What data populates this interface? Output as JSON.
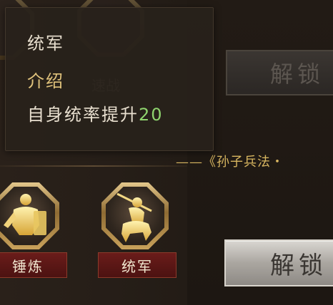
{
  "tooltip": {
    "title": "统军",
    "section_heading": "介绍",
    "description_prefix": "自身统率提升",
    "description_value": "20"
  },
  "background_skills": {
    "ghost_label_1": "速战"
  },
  "buttons": {
    "unlock_top": "解锁",
    "unlock_bottom": "解锁"
  },
  "quote": "——《孙子兵法・",
  "skills": [
    {
      "label": "锤炼",
      "icon": "armored-warrior-icon"
    },
    {
      "label": "统军",
      "icon": "mounted-general-icon"
    }
  ],
  "colors": {
    "gold_text": "#d9b761",
    "highlight_number": "#8fd46e",
    "label_bg": "#5a1716"
  }
}
